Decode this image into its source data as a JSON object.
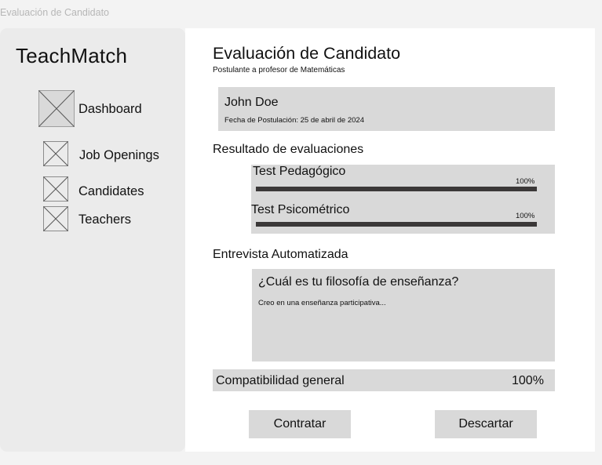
{
  "window": {
    "title": "Evaluación de Candidato"
  },
  "sidebar": {
    "brand": "TeachMatch",
    "items": [
      {
        "label": "Dashboard",
        "icon": "image-placeholder-icon"
      },
      {
        "label": "Job Openings",
        "icon": "image-placeholder-icon"
      },
      {
        "label": "Candidates",
        "icon": "image-placeholder-icon"
      },
      {
        "label": "Teachers",
        "icon": "image-placeholder-icon"
      }
    ]
  },
  "main": {
    "title": "Evaluación de Candidato",
    "subtitle": "Postulante a profesor de Matemáticas",
    "candidate": {
      "name": "John Doe",
      "applied_date": "Fecha de Postulación: 25 de abril de 2024"
    },
    "evaluations": {
      "heading": "Resultado de evaluaciones",
      "tests": [
        {
          "label": "Test Pedagógico",
          "percent_text": "100%",
          "progress": 1.0
        },
        {
          "label": "Test Psicométrico",
          "percent_text": "100%",
          "progress": 1.0
        }
      ]
    },
    "interview": {
      "heading": "Entrevista Automatizada",
      "question": "¿Cuál es tu filosofía de enseñanza?",
      "answer": "Creo en una enseñanza participativa..."
    },
    "compatibility": {
      "label": "Compatibilidad general",
      "value": "100%"
    },
    "actions": {
      "hire_label": "Contratar",
      "discard_label": "Descartar"
    }
  },
  "colors": {
    "page_bg": "#f3f3f3",
    "sidebar_bg": "#ebebeb",
    "panel_bg": "#ffffff",
    "box_bg": "#d9d9d9",
    "progress_fill": "#3b3838"
  }
}
